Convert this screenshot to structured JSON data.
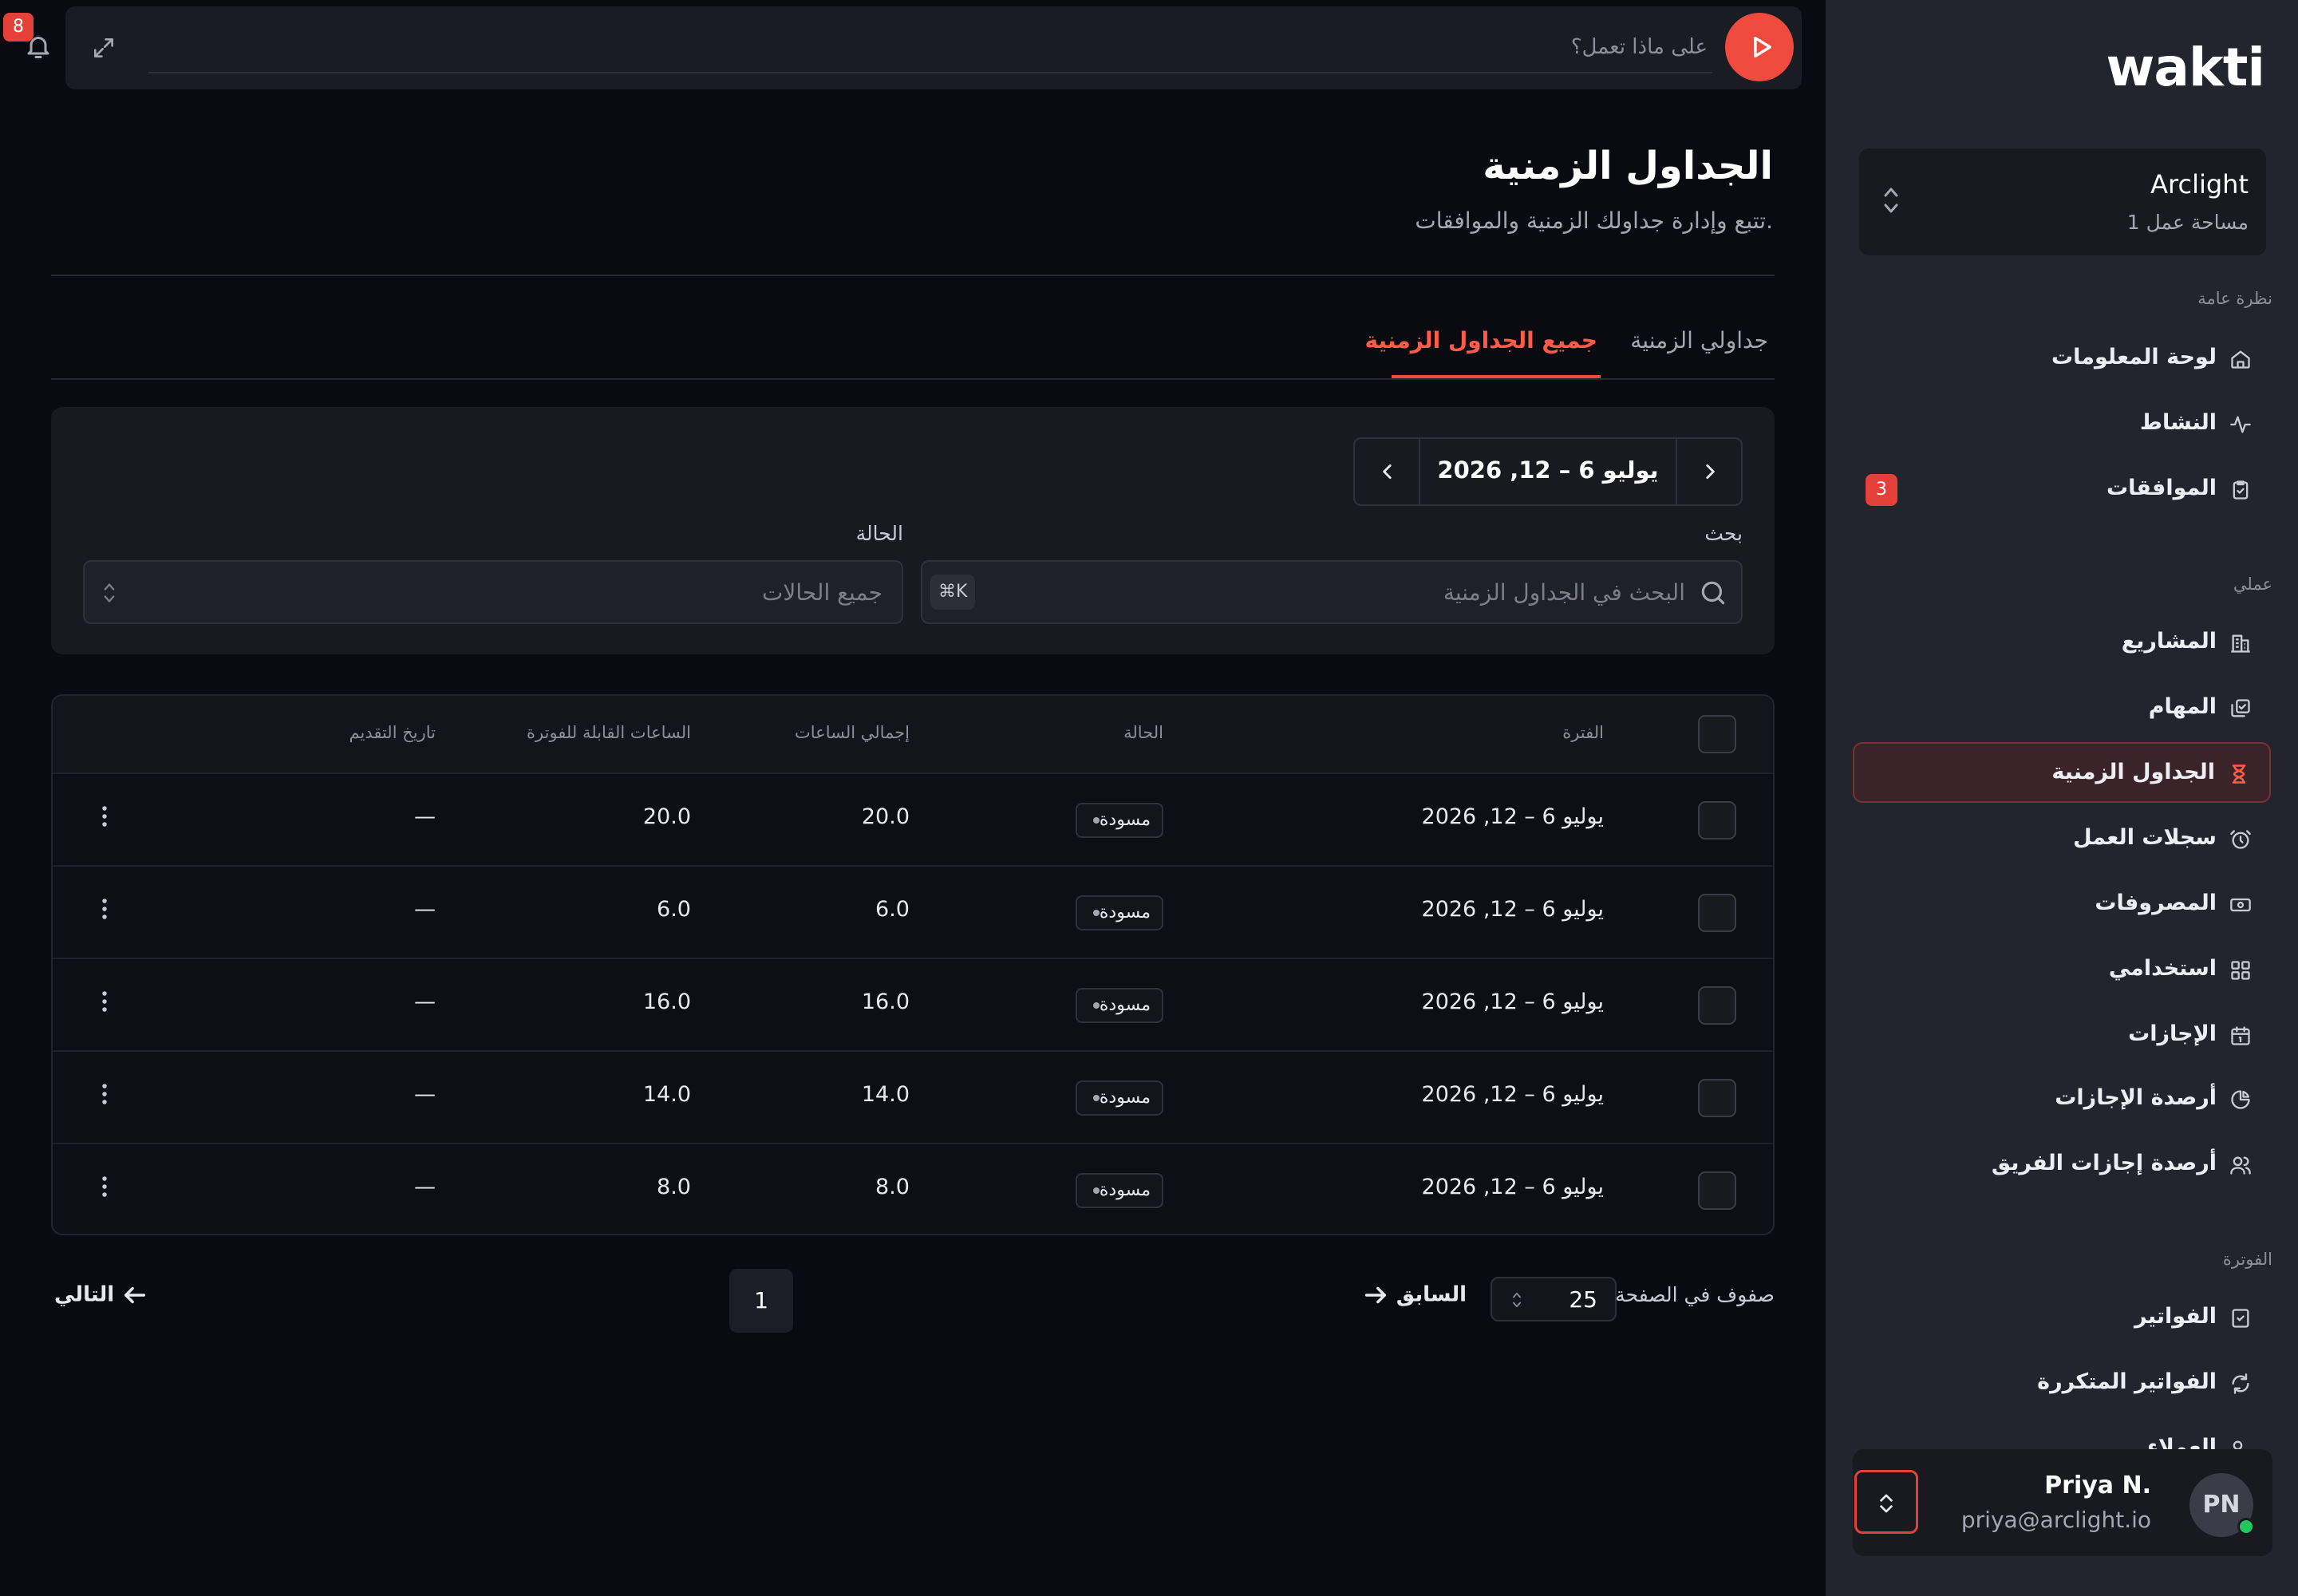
{
  "sidebar": {
    "logo": "wakti",
    "workspace": {
      "name": "Arclight",
      "count": "1 مساحة عمل"
    },
    "sections": [
      {
        "title": "نظرة عامة"
      },
      {
        "title": "عملي"
      },
      {
        "title": "الفوترة"
      }
    ],
    "items": [
      {
        "label": "لوحة المعلومات",
        "icon": "home-icon"
      },
      {
        "label": "النشاط",
        "icon": "activity-icon"
      },
      {
        "label": "الموافقات",
        "icon": "clipboard-check-icon",
        "badge": "3"
      },
      {
        "label": "المشاريع",
        "icon": "building-icon"
      },
      {
        "label": "المهام",
        "icon": "tasks-icon"
      },
      {
        "label": "الجداول الزمنية",
        "icon": "hourglass-icon",
        "active": true
      },
      {
        "label": "سجلات العمل",
        "icon": "alarm-clock-icon"
      },
      {
        "label": "المصروفات",
        "icon": "money-icon"
      },
      {
        "label": "استخدامي",
        "icon": "grid-icon"
      },
      {
        "label": "الإجازات",
        "icon": "calendar-icon"
      },
      {
        "label": "أرصدة الإجازات",
        "icon": "pie-icon"
      },
      {
        "label": "أرصدة إجازات الفريق",
        "icon": "team-icon"
      },
      {
        "label": "الفواتير",
        "icon": "invoice-icon"
      },
      {
        "label": "الفواتير المتكررة",
        "icon": "recurring-icon"
      },
      {
        "label": "العملاء",
        "icon": "clients-icon"
      }
    ],
    "user": {
      "initials": "PN",
      "name": "Priya N.",
      "email": "priya@arclight.io"
    }
  },
  "topbar": {
    "task_placeholder": "على ماذا تعمل؟",
    "notification_count": "8"
  },
  "page": {
    "title": "الجداول الزمنية",
    "subtitle": "تتبع وإدارة جداولك الزمنية والموافقات.",
    "tabs": [
      {
        "label": "جداولي الزمنية",
        "active": false
      },
      {
        "label": "جميع الجداول الزمنية",
        "active": true
      }
    ]
  },
  "filters": {
    "date_range": "يوليو 6 – 12, 2026",
    "search_label": "بحث",
    "search_placeholder": "البحث في الجداول الزمنية",
    "search_shortcut": "⌘K",
    "status_label": "الحالة",
    "status_value": "جميع الحالات"
  },
  "table": {
    "columns": {
      "period": "الفترة",
      "status": "الحالة",
      "total_hours": "إجمالي الساعات",
      "billable_hours": "الساعات القابلة للفوترة",
      "submitted": "تاريخ التقديم"
    },
    "rows": [
      {
        "period": "يوليو 6 – 12, 2026",
        "status": "مسودة",
        "total": "20.0",
        "billable": "20.0",
        "submitted": "—"
      },
      {
        "period": "يوليو 6 – 12, 2026",
        "status": "مسودة",
        "total": "6.0",
        "billable": "6.0",
        "submitted": "—"
      },
      {
        "period": "يوليو 6 – 12, 2026",
        "status": "مسودة",
        "total": "16.0",
        "billable": "16.0",
        "submitted": "—"
      },
      {
        "period": "يوليو 6 – 12, 2026",
        "status": "مسودة",
        "total": "14.0",
        "billable": "14.0",
        "submitted": "—"
      },
      {
        "period": "يوليو 6 – 12, 2026",
        "status": "مسودة",
        "total": "8.0",
        "billable": "8.0",
        "submitted": "—"
      }
    ]
  },
  "pagination": {
    "rows_per_page_label": "صفوف في الصفحة",
    "rows_per_page": "25",
    "previous": "السابق",
    "page": "1",
    "next": "التالي"
  },
  "colors": {
    "accent": "#ef4a3e",
    "bg": "#0a0b10",
    "sidebar": "#23252e"
  }
}
